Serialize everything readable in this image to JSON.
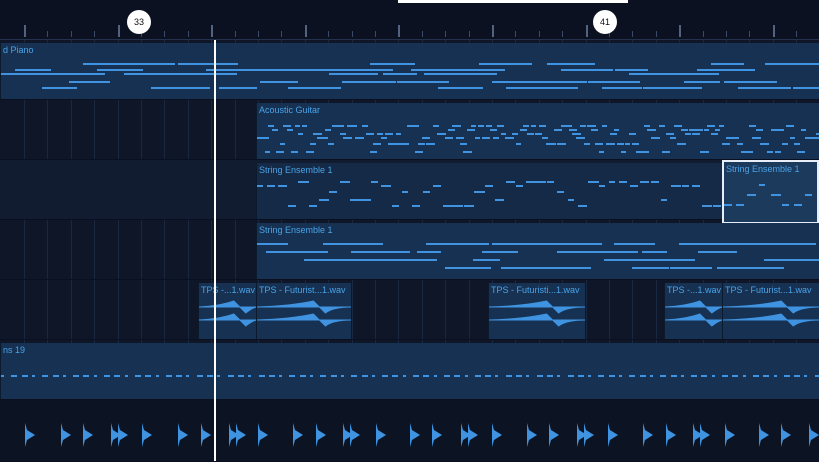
{
  "ruler": {
    "markers": [
      {
        "label": "33"
      },
      {
        "label": "41"
      }
    ]
  },
  "tracks": [
    {
      "id": "piano",
      "regions": [
        {
          "name": "d Piano"
        }
      ]
    },
    {
      "id": "guitar",
      "regions": [
        {
          "name": "Acoustic Guitar"
        }
      ]
    },
    {
      "id": "strings1",
      "regions": [
        {
          "name": "String Ensemble 1"
        },
        {
          "name": "String Ensemble 1"
        }
      ]
    },
    {
      "id": "strings2",
      "regions": [
        {
          "name": "String Ensemble 1"
        }
      ]
    },
    {
      "id": "audio",
      "regions": [
        {
          "name": "TPS -...1.wav"
        },
        {
          "name": "TPS - Futurist...1.wav"
        },
        {
          "name": "TPS - Futuristi...1.wav"
        },
        {
          "name": "TPS -...1.wav"
        },
        {
          "name": "TPS - Futurist...1.wav"
        }
      ]
    },
    {
      "id": "drums",
      "regions": [
        {
          "name": "ns 19"
        }
      ]
    },
    {
      "id": "percussion",
      "regions": []
    }
  ],
  "colors": {
    "background": "#0e1628",
    "region": "#163152",
    "note": "#3f93e0",
    "label": "#4aa3e8",
    "playhead": "#ffffff"
  }
}
